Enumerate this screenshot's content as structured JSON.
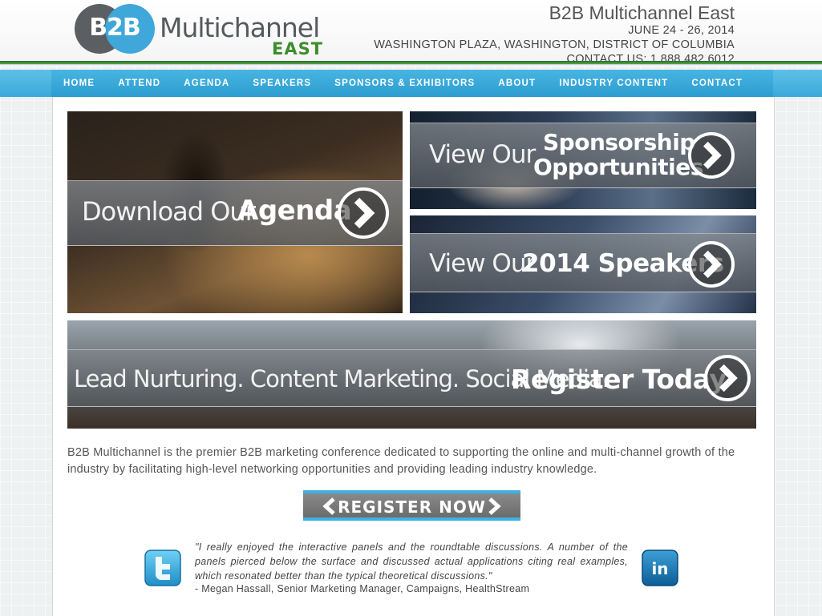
{
  "logo": {
    "mark": "B2B",
    "name": "Multichannel",
    "region": "EAST"
  },
  "event": {
    "title": "B2B Multichannel East",
    "dates": "JUNE 24 - 26, 2014",
    "venue": "WASHINGTON PLAZA, WASHINGTON, DISTRICT OF COLUMBIA",
    "contact": "CONTACT US: 1.888.482.6012"
  },
  "nav": [
    "HOME",
    "ATTEND",
    "AGENDA",
    "SPEAKERS",
    "SPONSORS & EXHIBITORS",
    "ABOUT",
    "INDUSTRY CONTENT",
    "CONTACT"
  ],
  "banners": {
    "agenda": {
      "thin": "Download Our",
      "bold": "Agenda"
    },
    "sponsor": {
      "thin": "View Our",
      "bold1": "Sponsorship",
      "bold2": "Opportunities"
    },
    "speakers": {
      "thin": "View Our",
      "bold": "2014 Speakers"
    },
    "register": {
      "thin": "Lead Nurturing. Content Marketing. Social Media.",
      "bold": "Register Today"
    }
  },
  "intro": "B2B Multichannel is the premier B2B marketing conference dedicated to supporting the online and multi-channel growth of the industry by facilitating high-level networking opportunities and providing leading industry knowledge.",
  "register_button": "REGISTER NOW",
  "testimonial": {
    "quote": "\"I really enjoyed the interactive panels and the roundtable discussions. A number of the panels pierced below the surface and discussed actual applications citing real examples, which resonated better than the typical theoretical discussions.\"",
    "author": "- Megan Hassall, Senior Marketing Manager, Campaigns, HealthStream"
  },
  "social": {
    "left": "twitter-icon",
    "right": "linkedin-icon",
    "linkedin_text": "in"
  },
  "colors": {
    "nav_blue": "#3aa9d9",
    "brand_green": "#3d8d2d",
    "brand_blue": "#3fa7d9"
  }
}
